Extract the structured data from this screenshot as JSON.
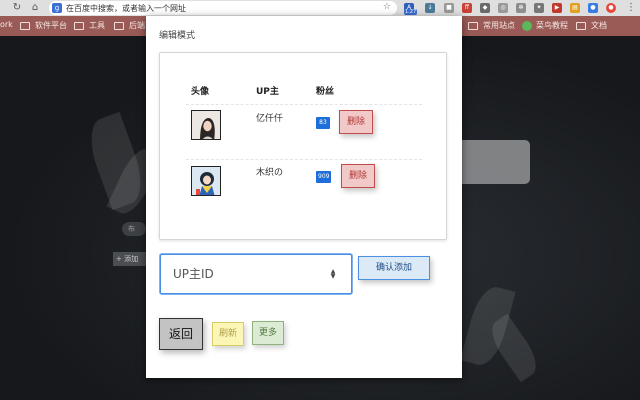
{
  "browser": {
    "address_placeholder": "在百度中搜索，或者输入一个网址",
    "extension_badge": "1.27"
  },
  "bookmarks": [
    {
      "label": "ork"
    },
    {
      "label": "软件平台"
    },
    {
      "label": "工具"
    },
    {
      "label": "后端"
    },
    {
      "label": "常用站点"
    },
    {
      "label": "菜鸟教程"
    },
    {
      "label": "文档"
    }
  ],
  "background": {
    "pill_label": "布",
    "add_label": "+ 添加"
  },
  "popup": {
    "title": "编辑模式",
    "table": {
      "headers": {
        "avatar": "头像",
        "up": "UP主",
        "fans": "粉丝"
      },
      "rows": [
        {
          "name": "亿仟仟",
          "fans": "83",
          "delete_label": "删除"
        },
        {
          "name": "木织の",
          "fans": "909",
          "delete_label": "删除"
        }
      ]
    },
    "input": {
      "placeholder": "UP主ID"
    },
    "confirm_label": "确认添加",
    "back_label": "返回",
    "refresh_label": "刷新",
    "more_label": "更多"
  },
  "colors": {
    "bookmark_bar": "#9a5a55",
    "fans_badge": "#1d6ed9",
    "delete_bg": "#f1c9c9",
    "confirm_border": "#4a90e2"
  }
}
